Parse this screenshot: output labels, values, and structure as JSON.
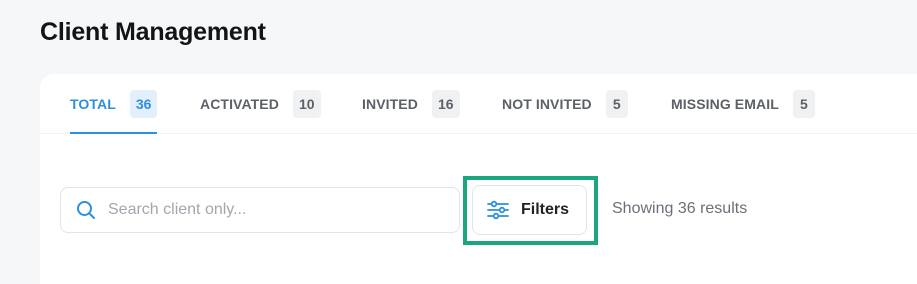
{
  "page": {
    "title": "Client Management"
  },
  "tabs": [
    {
      "label": "TOTAL",
      "count": "36",
      "active": true
    },
    {
      "label": "ACTIVATED",
      "count": "10",
      "active": false
    },
    {
      "label": "INVITED",
      "count": "16",
      "active": false
    },
    {
      "label": "NOT INVITED",
      "count": "5",
      "active": false
    },
    {
      "label": "MISSING EMAIL",
      "count": "5",
      "active": false
    }
  ],
  "search": {
    "placeholder": "Search client only...",
    "value": "",
    "icon": "search-icon"
  },
  "filters": {
    "label": "Filters",
    "icon": "sliders-icon",
    "highlight_color": "#1aa67f"
  },
  "results": {
    "text": "Showing 36 results"
  },
  "colors": {
    "accent": "#2d8fe0",
    "highlight": "#1aa67f",
    "title": "#111418"
  }
}
